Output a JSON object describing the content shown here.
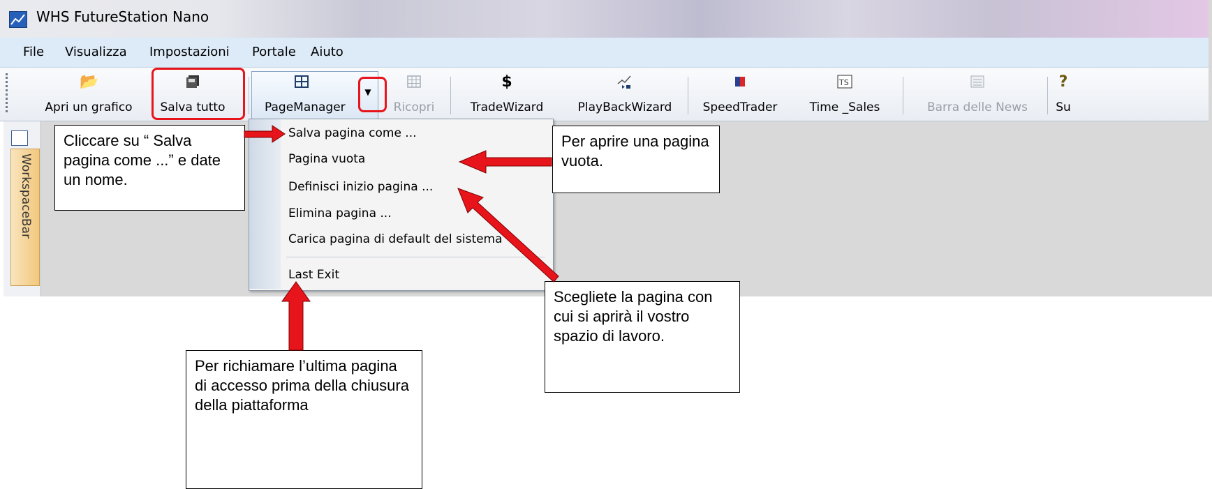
{
  "window": {
    "title": "WHS FutureStation Nano"
  },
  "menubar": {
    "items": [
      "File",
      "Visualizza",
      "Impostazioni",
      "Portale",
      "Aiuto"
    ]
  },
  "toolbar": {
    "open_chart": "Apri un grafico",
    "save_all": "Salva tutto",
    "page_manager": "PageManager",
    "tile": "Ricopri",
    "trade_wizard": "TradeWizard",
    "playback_wizard": "PlayBackWizard",
    "speed_trader": "SpeedTrader",
    "time_sales": "Time _Sales",
    "news_bar": "Barra delle News",
    "help": "Su"
  },
  "sidebar": {
    "workspace_bar": "WorkspaceBar"
  },
  "dropdown": {
    "items": [
      "Salva pagina come ...",
      "Pagina vuota",
      "Definisci inizio pagina ...",
      "Elimina pagina ...",
      "Carica pagina di default del sistema",
      "Last Exit"
    ]
  },
  "callouts": {
    "save_page": "Cliccare su “ Salva pagina come ...” e date un nome.",
    "blank_page": "Per aprire una pagina vuota.",
    "start_page": "Scegliete la pagina con cui si aprirà il vostro spazio di lavoro.",
    "last_exit": "Per richiamare l’ultima pagina di accesso prima della chiusura della piattaforma"
  },
  "colors": {
    "annotation_red": "#e8141b",
    "menubar": "#ddeaf7",
    "workspace": "#d9d9d9"
  }
}
